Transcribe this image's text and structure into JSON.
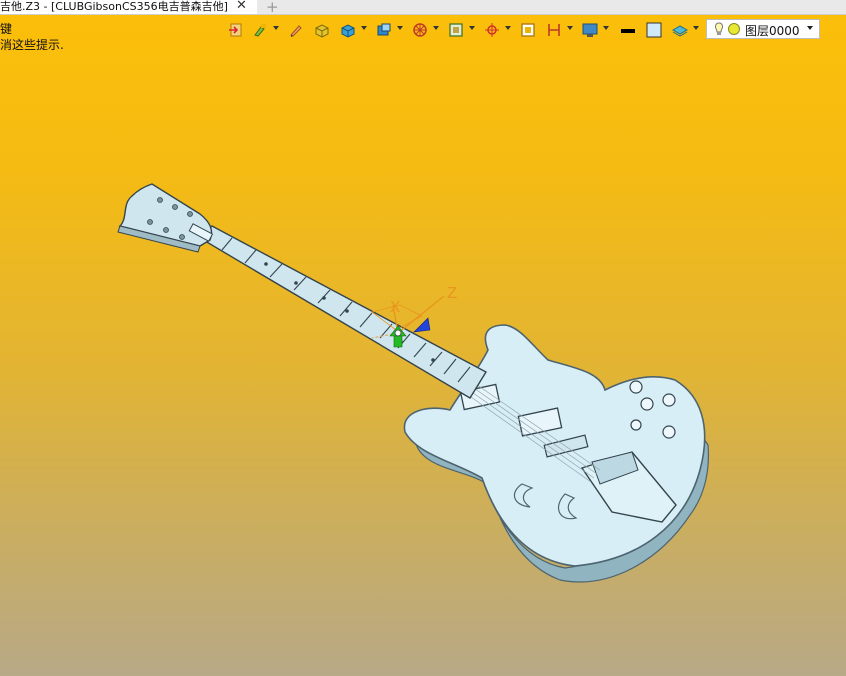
{
  "tab": {
    "title": "吉他.Z3 - [CLUBGibsonCS356电吉普森吉他]",
    "close_glyph": "✕",
    "new_glyph": "+"
  },
  "hints": {
    "line1": "键",
    "line2": "消这些提示."
  },
  "toolbar": {
    "icons": [
      "export-icon",
      "paint-brush-icon",
      "pencil-icon",
      "solid-box-icon",
      "shaded-box-icon",
      "view-cube-icon",
      "wheel-icon",
      "frame-icon",
      "target-icon",
      "square-select-icon",
      "dimension-icon",
      "monitor-icon",
      "line-color-swatch",
      "fill-swatch",
      "layer-stack-icon"
    ]
  },
  "layer": {
    "label": "图层0000"
  },
  "axes": {
    "x_label": "X",
    "z_label": "Z"
  },
  "colors": {
    "body_fill": "#d8eef6",
    "outline": "#5a6f7a",
    "axis_orange": "#e8961e",
    "axis_green": "#22bb22",
    "axis_blue": "#2244dd"
  }
}
